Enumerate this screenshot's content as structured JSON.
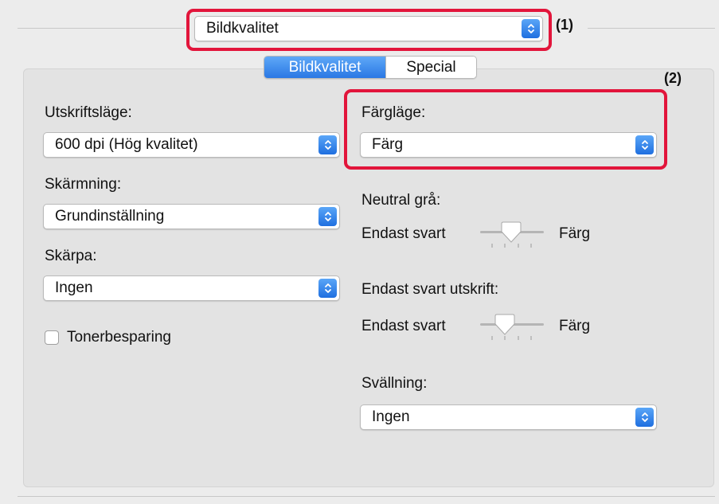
{
  "top_popup": {
    "value": "Bildkvalitet"
  },
  "callouts": {
    "one": "(1)",
    "two": "(2)"
  },
  "tabs": [
    {
      "label": "Bildkvalitet",
      "selected": true
    },
    {
      "label": "Special",
      "selected": false
    }
  ],
  "left": {
    "print_mode": {
      "label": "Utskriftsläge:",
      "value": "600 dpi (Hög kvalitet)"
    },
    "screening": {
      "label": "Skärmning:",
      "value": "Grundinställning"
    },
    "sharpness": {
      "label": "Skärpa:",
      "value": "Ingen"
    },
    "toner_save": {
      "label": "Tonerbesparing",
      "checked": false
    }
  },
  "right": {
    "color_mode": {
      "label": "Färgläge:",
      "value": "Färg"
    },
    "neutral_gray": {
      "label": "Neutral grå:",
      "left_label": "Endast svart",
      "right_label": "Färg",
      "level": 0.5
    },
    "black_only_print": {
      "label": "Endast svart utskrift:",
      "left_label": "Endast svart",
      "right_label": "Färg",
      "level": 0.33
    },
    "swelling": {
      "label": "Svällning:",
      "value": "Ingen"
    }
  },
  "colors": {
    "accent": "#2a78e4",
    "highlight": "#e2153b"
  }
}
